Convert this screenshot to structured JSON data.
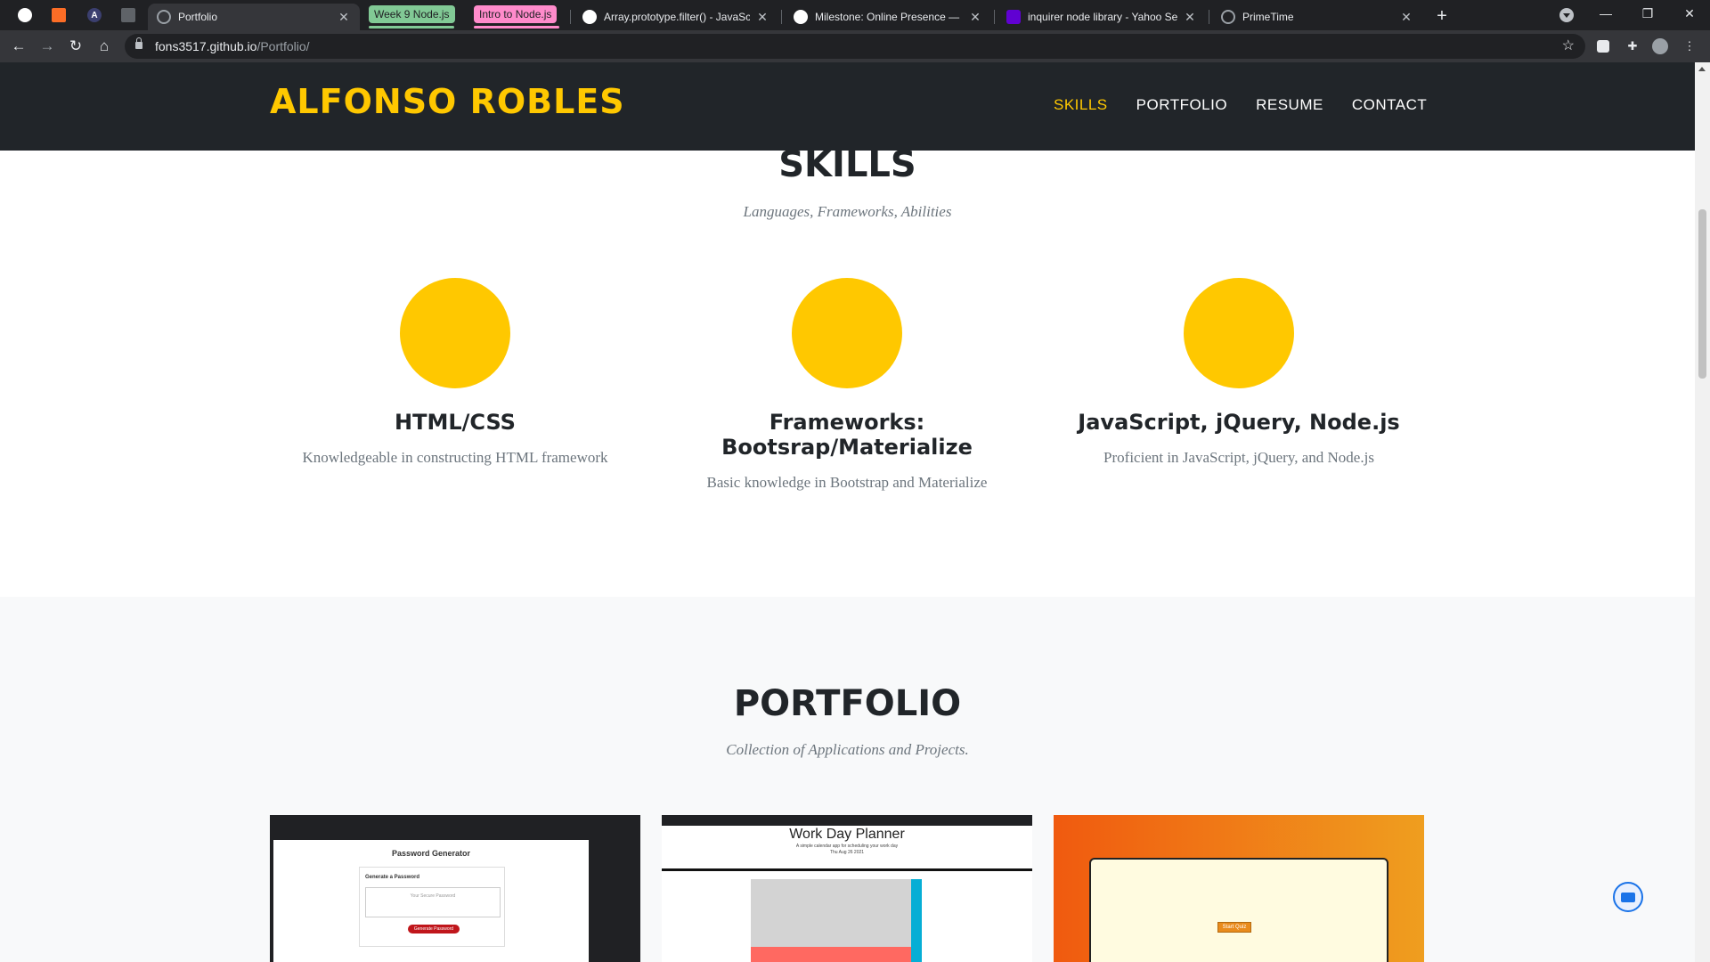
{
  "browser": {
    "pinned_tabs": [
      {
        "icon": "github-icon",
        "color": "#ffffff",
        "glyph": ""
      },
      {
        "icon": "gitlab-icon",
        "color": "#fc6d26",
        "glyph": ""
      },
      {
        "icon": "angular-icon",
        "color": "#3b3f6f",
        "glyph": "A"
      },
      {
        "icon": "book-icon",
        "color": "#2d2d2d",
        "glyph": ""
      }
    ],
    "tabs": {
      "active": "Portfolio",
      "group_1": "Week 9 Node.js",
      "group_2": "Intro to Node.js",
      "mdn": "Array.prototype.filter() - JavaScript",
      "milestone": "Milestone: Online Presence — MDN",
      "yahoo": "inquirer node library - Yahoo Search",
      "primetime": "PrimeTime"
    },
    "group_colors": {
      "group_1": "#81c995",
      "group_2": "#ff8bcb"
    },
    "url_host": "fons3517.github.io",
    "url_path": "/Portfolio/"
  },
  "site": {
    "brand": "ALFONSO ROBLES",
    "nav": [
      "SKILLS",
      "PORTFOLIO",
      "RESUME",
      "CONTACT"
    ],
    "accent_color": "#ffc800",
    "skills": {
      "title": "SKILLS",
      "subtitle": "Languages, Frameworks, Abilities",
      "items": [
        {
          "title": "HTML/CSS",
          "desc": "Knowledgeable in constructing HTML framework"
        },
        {
          "title_line1": "Frameworks:",
          "title_line2": "Bootsrap/Materialize",
          "desc": "Basic knowledge in Bootstrap and Materialize"
        },
        {
          "title": "JavaScript, jQuery, Node.js",
          "desc": "Proficient in JavaScript, jQuery, and Node.js"
        }
      ]
    },
    "portfolio": {
      "title": "PORTFOLIO",
      "subtitle": "Collection of Applications and Projects.",
      "projects": [
        {
          "title": "Password Generator",
          "label": "Generate a Password",
          "placeholder": "Your Secure Password",
          "button": "Generate Password"
        },
        {
          "title": "Work Day Planner",
          "subtitle": "A simple calendar app for scheduling your work day",
          "date": "Thu Aug 26 2021"
        },
        {
          "button": "Start Quiz"
        }
      ]
    }
  }
}
